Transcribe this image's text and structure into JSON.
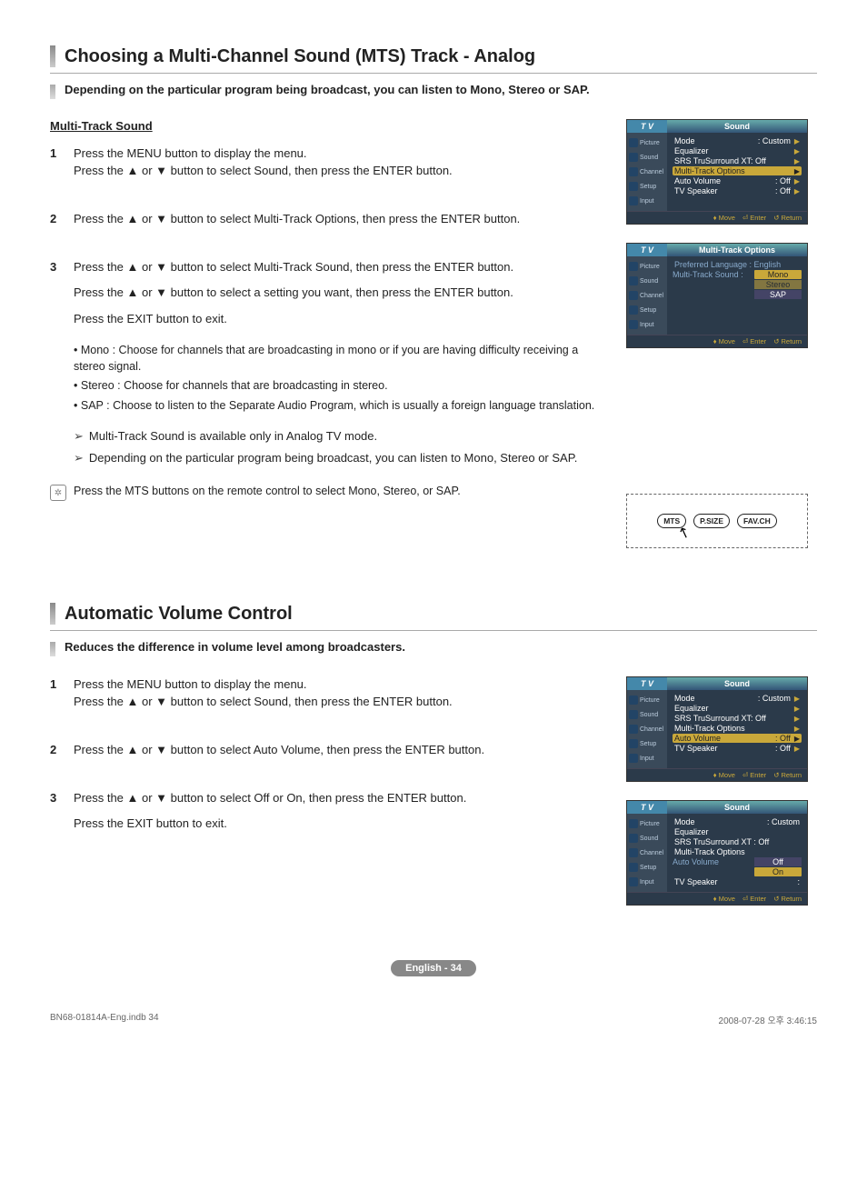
{
  "section1": {
    "title": "Choosing a Multi-Channel Sound (MTS) Track - Analog",
    "subtitle": "Depending on the particular program being broadcast, you can listen to Mono, Stereo or SAP.",
    "label": "Multi-Track Sound",
    "steps": {
      "s1": "Press the MENU button to display the menu.\nPress the ▲ or ▼ button to select Sound, then press the ENTER button.",
      "s2": "Press the ▲ or ▼ button to select Multi-Track Options, then press the ENTER button.",
      "s3a": "Press the ▲ or ▼ button to select Multi-Track Sound, then press the ENTER button.",
      "s3b": "Press the ▲ or ▼ button to select a setting you want, then press the ENTER button.",
      "s3c": "Press the EXIT button to exit."
    },
    "bullets": {
      "mono": "Mono : Choose for channels that are broadcasting in mono or if you are having difficulty receiving a stereo signal.",
      "stereo": "Stereo : Choose for channels that are broadcasting in stereo.",
      "sap": "SAP : Choose to listen to the Separate Audio Program, which is usually a foreign language translation."
    },
    "notes": {
      "n1": "Multi-Track Sound is available only in Analog TV mode.",
      "n2": "Depending on the particular program being broadcast, you can listen to Mono, Stereo or SAP."
    },
    "remote": "Press the MTS buttons on the remote control to select Mono, Stereo, or SAP."
  },
  "section2": {
    "title": "Automatic Volume Control",
    "subtitle": "Reduces the difference in volume level among broadcasters.",
    "steps": {
      "s1": "Press the MENU button to display the menu.\nPress the ▲ or ▼ button to select Sound, then press the ENTER button.",
      "s2": "Press the ▲ or ▼ button to select Auto Volume, then press the ENTER button.",
      "s3a": "Press the ▲ or ▼ button to select Off or On, then press the ENTER button.",
      "s3b": "Press the EXIT button to exit."
    }
  },
  "osd": {
    "tv": "T V",
    "sound": "Sound",
    "side": {
      "picture": "Picture",
      "soundTab": "Sound",
      "channel": "Channel",
      "setup": "Setup",
      "input": "Input"
    },
    "menu1": {
      "mode": "Mode",
      "modeVal": ": Custom",
      "eq": "Equalizer",
      "srs": "SRS TruSurround XT: Off",
      "mts": "Multi-Track Options",
      "autoVol": "Auto Volume",
      "autoVolVal": ": Off",
      "tvspk": "TV Speaker",
      "tvspkVal": ": Off"
    },
    "menu2": {
      "title": "Multi-Track Options",
      "pref": "Preferred Language : English",
      "mtsSound": "Multi-Track Sound :",
      "opt1": "Mono",
      "opt2": "Stereo",
      "opt3": "SAP"
    },
    "menu4": {
      "autoVolLbl": "Auto Volume",
      "optOff": "Off",
      "optOn": "On"
    },
    "foot": {
      "move": "Move",
      "enter": "Enter",
      "return": "Return"
    }
  },
  "remoteBtns": {
    "mts": "MTS",
    "psize": "P.SIZE",
    "favch": "FAV.CH"
  },
  "pageBadge": "English - 34",
  "docFoot": {
    "left": "BN68-01814A-Eng.indb   34",
    "right": "2008-07-28   오후 3:46:15"
  }
}
